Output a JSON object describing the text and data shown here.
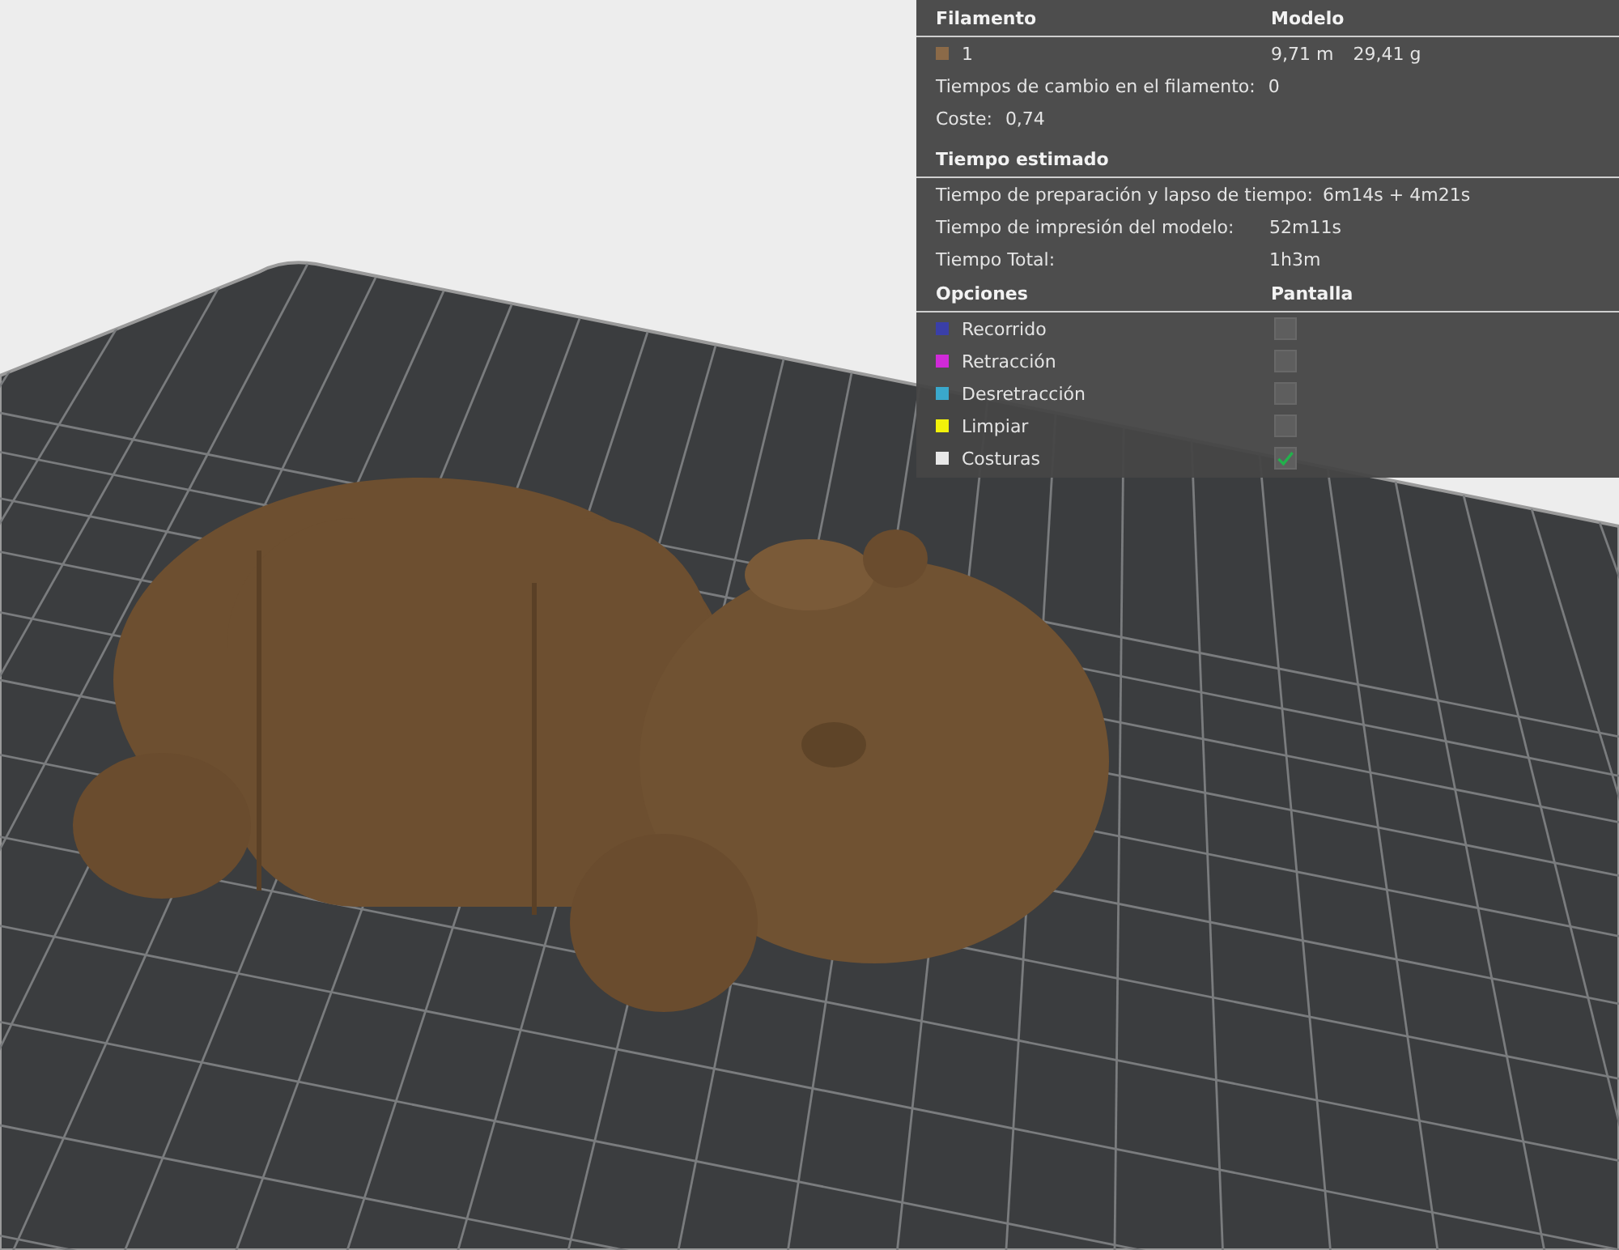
{
  "panel": {
    "filament_header": "Filamento",
    "model_header": "Modelo",
    "filaments": [
      {
        "color": "#8b6a48",
        "index": "1",
        "length": "9,71 m",
        "weight": "29,41 g"
      }
    ],
    "changes": {
      "label": "Tiempos de cambio en el filamento:",
      "value": "0"
    },
    "cost": {
      "label": "Coste:",
      "value": "0,74"
    },
    "time_title": "Tiempo estimado",
    "times": [
      {
        "label": "Tiempo de preparación y lapso de tiempo:",
        "value": "6m14s + 4m21s"
      },
      {
        "label": "Tiempo de impresión del modelo:",
        "value": "52m11s"
      },
      {
        "label": "Tiempo Total:",
        "value": "1h3m"
      }
    ],
    "options_header": "Opciones",
    "display_header": "Pantalla",
    "options": [
      {
        "label": "Recorrido",
        "color": "#3a3fa8",
        "checked": false
      },
      {
        "label": "Retracción",
        "color": "#d02ad8",
        "checked": false
      },
      {
        "label": "Desretracción",
        "color": "#3aa8cc",
        "checked": false
      },
      {
        "label": "Limpiar",
        "color": "#f2f20a",
        "checked": false
      },
      {
        "label": "Costuras",
        "color": "#e8e8e8",
        "checked": true
      }
    ]
  }
}
